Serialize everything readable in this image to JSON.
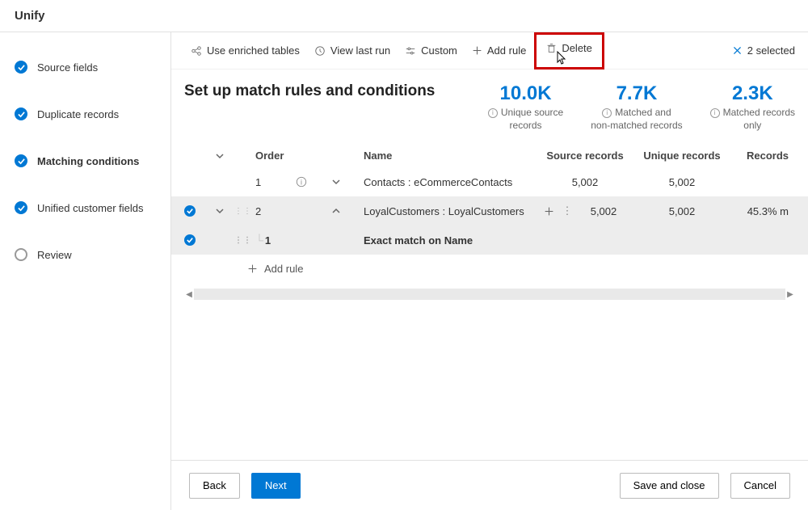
{
  "header": {
    "title": "Unify"
  },
  "sidebar": {
    "items": [
      {
        "label": "Source fields",
        "state": "done"
      },
      {
        "label": "Duplicate records",
        "state": "done"
      },
      {
        "label": "Matching conditions",
        "state": "done",
        "active": true
      },
      {
        "label": "Unified customer fields",
        "state": "done"
      },
      {
        "label": "Review",
        "state": "pending"
      }
    ]
  },
  "toolbar": {
    "enriched": "Use enriched tables",
    "viewlast": "View last run",
    "custom": "Custom",
    "addrule": "Add rule",
    "delete": "Delete",
    "selected": "2 selected"
  },
  "page": {
    "title": "Set up match rules and conditions"
  },
  "stats": [
    {
      "num": "10.0K",
      "label1": "Unique source",
      "label2": "records"
    },
    {
      "num": "7.7K",
      "label1": "Matched and",
      "label2": "non-matched records"
    },
    {
      "num": "2.3K",
      "label1": "Matched records",
      "label2": "only"
    }
  ],
  "grid": {
    "headers": {
      "order": "Order",
      "name": "Name",
      "source": "Source records",
      "unique": "Unique records",
      "records": "Records"
    },
    "rows": [
      {
        "order": "1",
        "name": "Contacts : eCommerceContacts",
        "source": "5,002",
        "unique": "5,002",
        "records": "",
        "selected": false,
        "hasInfo": true,
        "expandDir": "down"
      },
      {
        "order": "2",
        "name": "LoyalCustomers : LoyalCustomers",
        "source": "5,002",
        "unique": "5,002",
        "records": "45.3% m",
        "selected": true,
        "hasDrag": true,
        "hasPlus": true,
        "expandDir": "up"
      }
    ],
    "subrow": {
      "order": "1",
      "name": "Exact match on Name"
    },
    "addrule": "Add rule"
  },
  "footer": {
    "back": "Back",
    "next": "Next",
    "save": "Save and close",
    "cancel": "Cancel"
  }
}
